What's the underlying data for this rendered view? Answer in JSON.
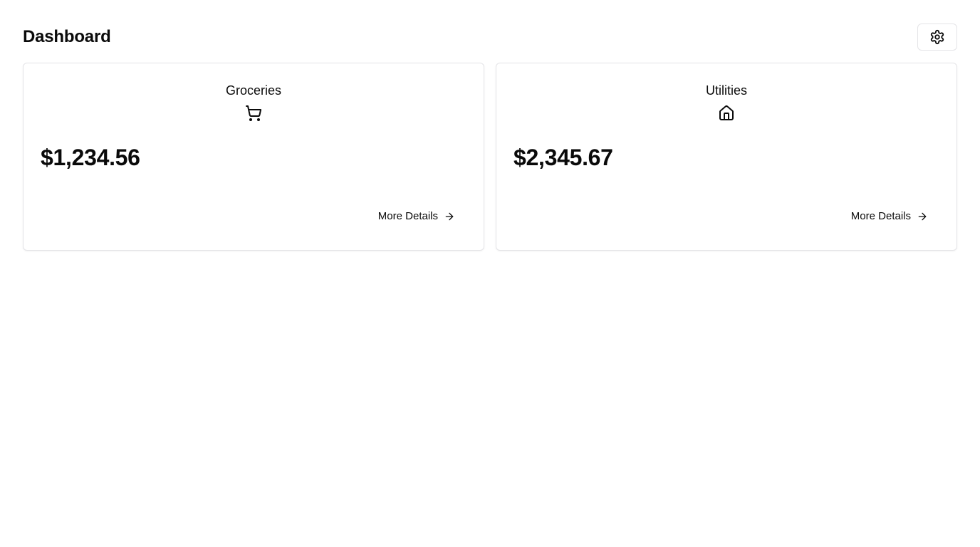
{
  "header": {
    "title": "Dashboard",
    "settings_icon": "gear-icon"
  },
  "cards": [
    {
      "title": "Groceries",
      "icon": "shopping-cart-icon",
      "amount": "$1,234.56",
      "link_label": "More Details",
      "link_icon": "arrow-right-icon"
    },
    {
      "title": "Utilities",
      "icon": "home-icon",
      "amount": "$2,345.67",
      "link_label": "More Details",
      "link_icon": "arrow-right-icon"
    }
  ]
}
